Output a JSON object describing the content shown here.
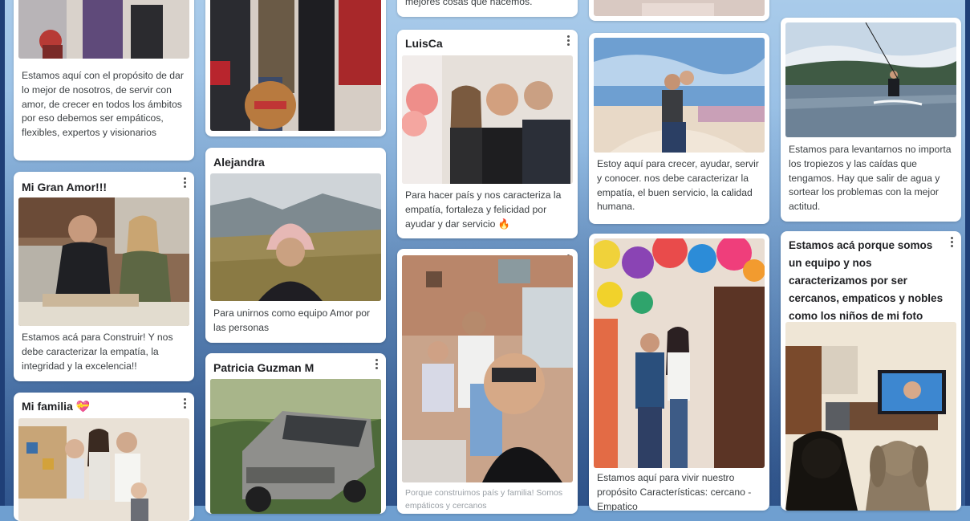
{
  "posts": {
    "c1_top": {
      "text": "Estamos aquí con el propósito de dar lo mejor de nosotros, de servir con amor, de crecer en todos los ámbitos por eso debemos ser empáticos, flexibles, expertos y visionarios"
    },
    "c1_amor": {
      "author": "Mi Gran Amor!!!",
      "text": "Estamos acá para Construir! Y nos debe caracterizar la empatía, la integridad y la excelencia!!"
    },
    "c1_familia": {
      "author": "Mi familia 💝"
    },
    "c2_alejandra": {
      "author": "Alejandra",
      "text": "Para unirnos como equipo Amor por las personas"
    },
    "c2_patricia": {
      "author": "Patricia Guzman M"
    },
    "c3_top": {
      "text": "mejores cosas que hacemos."
    },
    "c3_luisca": {
      "author": "LuisCa",
      "text": "Para hacer país y nos caracteriza la empatía, fortaleza y felicidad por ayudar y dar servicio 🔥"
    },
    "c3_selfie": {
      "text": "Porque construimos país y familia! Somos empáticos y cercanos"
    },
    "c4_beach": {
      "text": "Estoy aquí para crecer, ayudar, servir y conocer. nos debe caracterizar la empatía, el buen servicio, la calidad humana."
    },
    "c4_party": {
      "text": "Estamos aquí para vivir nuestro propósito Características: cercano - Empatico"
    },
    "c5_lake": {
      "text": "Estamos para levantarnos no importa los tropiezos y las caídas que tengamos. Hay que salir de agua y sortear los problemas con la mejor actitud."
    },
    "c5_dogs": {
      "title": "Estamos acá porque somos un equipo y nos caracterizamos por ser cercanos, empaticos y nobles como los niños de mi foto"
    }
  },
  "icons": {
    "menu": "more-vertical-icon"
  }
}
